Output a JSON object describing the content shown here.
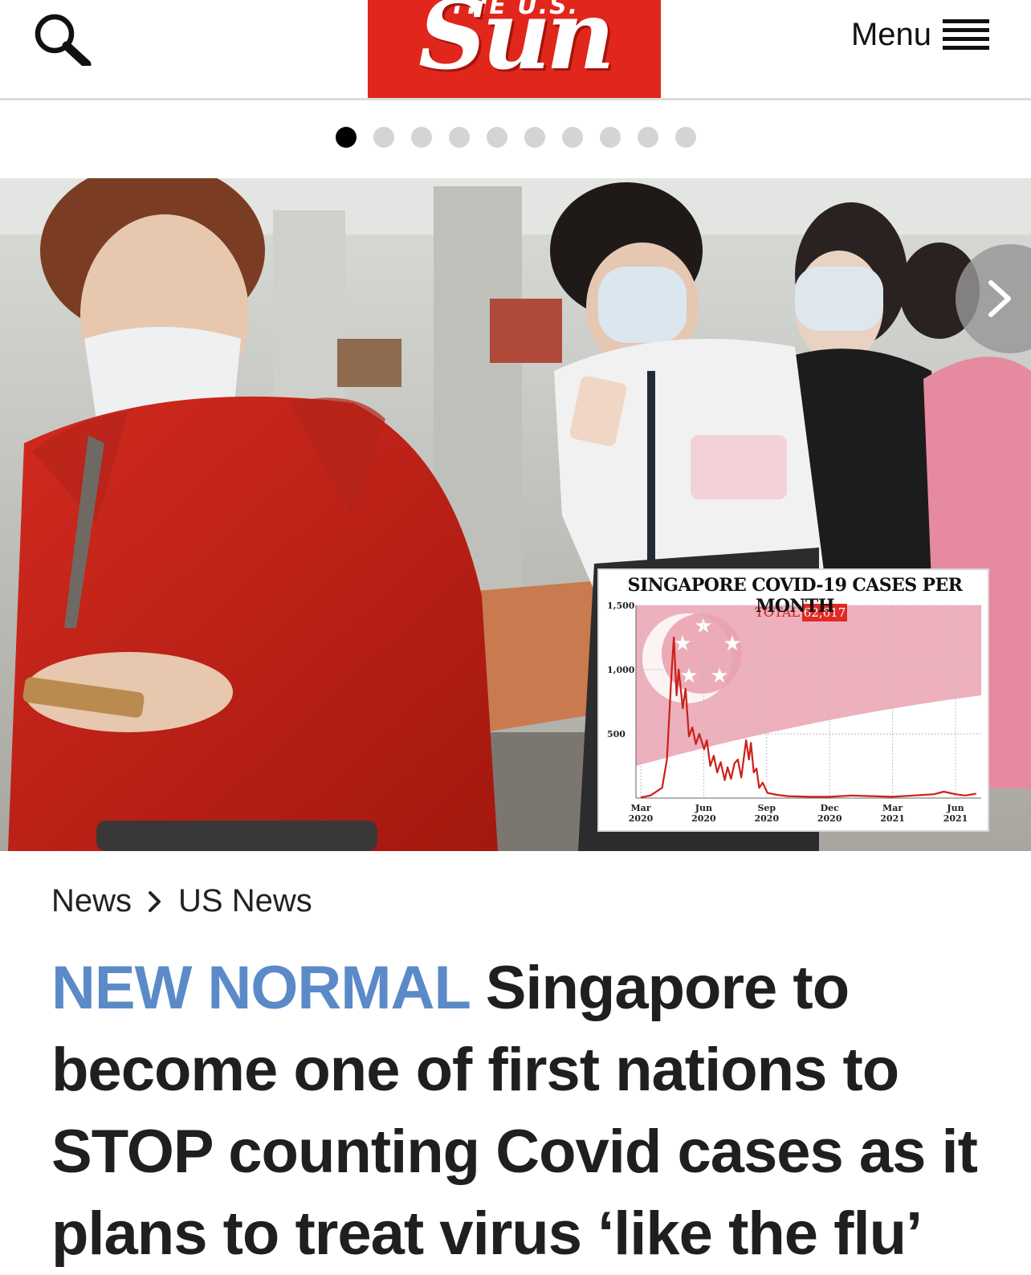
{
  "header": {
    "logo_top_text": "THE U.S.",
    "logo_main_text": "Sun",
    "menu_label": "Menu",
    "brand_color": "#e1261c"
  },
  "carousel": {
    "dot_count": 10,
    "active_index": 0
  },
  "chart_data": {
    "type": "line",
    "title": "SINGAPORE COVID-19 CASES PER MONTH",
    "total_label": "TOTAL",
    "total_value": "62,617",
    "yticks": [
      "1,500",
      "1,000",
      "500"
    ],
    "ylim": [
      0,
      1500
    ],
    "xticks": [
      {
        "month": "Mar",
        "year": "2020"
      },
      {
        "month": "Jun",
        "year": "2020"
      },
      {
        "month": "Sep",
        "year": "2020"
      },
      {
        "month": "Dec",
        "year": "2020"
      },
      {
        "month": "Mar",
        "year": "2021"
      },
      {
        "month": "Jun",
        "year": "2021"
      }
    ],
    "grid": true,
    "line_color": "#cc1f1a",
    "series": [
      {
        "x": [
          "2020-03-01",
          "2020-03-15",
          "2020-04-01",
          "2020-04-08",
          "2020-04-12",
          "2020-04-15",
          "2020-04-18",
          "2020-04-22",
          "2020-04-25",
          "2020-05-01",
          "2020-05-05",
          "2020-05-10",
          "2020-05-15",
          "2020-05-20",
          "2020-05-25",
          "2020-06-01",
          "2020-06-05",
          "2020-06-10",
          "2020-06-15",
          "2020-06-20",
          "2020-06-25",
          "2020-07-01",
          "2020-07-05",
          "2020-07-10",
          "2020-07-15",
          "2020-07-20",
          "2020-07-25",
          "2020-08-01",
          "2020-08-05",
          "2020-08-08",
          "2020-08-12",
          "2020-08-16",
          "2020-08-20",
          "2020-08-25",
          "2020-09-01",
          "2020-09-15",
          "2020-10-01",
          "2020-11-01",
          "2020-12-01",
          "2021-01-01",
          "2021-02-01",
          "2021-03-01",
          "2021-04-01",
          "2021-05-01",
          "2021-05-15",
          "2021-06-01",
          "2021-06-15",
          "2021-07-01"
        ],
        "y": [
          5,
          20,
          80,
          300,
          700,
          1000,
          1250,
          800,
          1000,
          700,
          850,
          480,
          550,
          420,
          500,
          380,
          450,
          250,
          330,
          200,
          280,
          140,
          240,
          150,
          270,
          300,
          160,
          450,
          300,
          430,
          200,
          230,
          80,
          120,
          40,
          25,
          15,
          10,
          10,
          20,
          15,
          10,
          20,
          30,
          50,
          30,
          20,
          35
        ]
      }
    ]
  },
  "breadcrumb": {
    "items": [
      "News",
      "US News"
    ]
  },
  "article": {
    "kicker": "NEW NORMAL",
    "headline": "Singapore to become one of first nations to STOP counting Covid cases as it plans to treat virus ‘like the flu’",
    "kicker_color": "#5b8ac8"
  }
}
